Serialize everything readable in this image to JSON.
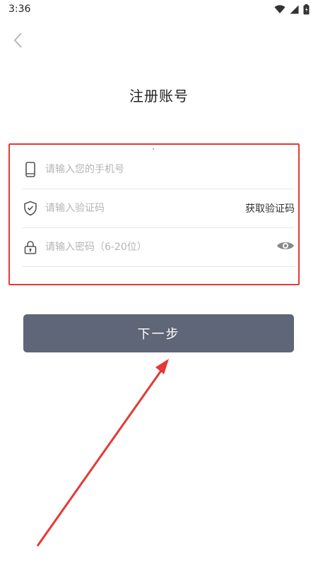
{
  "status_bar": {
    "time": "3:36",
    "icons": [
      "wifi-icon",
      "signal-icon",
      "battery-icon"
    ]
  },
  "header": {
    "back_icon": "chevron-left-icon",
    "title": "注册账号"
  },
  "form": {
    "phone": {
      "icon": "phone-icon",
      "placeholder": "请输入您的手机号",
      "value": ""
    },
    "code": {
      "icon": "shield-icon",
      "placeholder": "请输入验证码",
      "value": "",
      "action_label": "获取验证码"
    },
    "password": {
      "icon": "lock-icon",
      "placeholder": "请输入密码（6-20位）",
      "value": "",
      "toggle_icon": "eye-icon"
    }
  },
  "next_button": {
    "label": "下一步"
  },
  "colors": {
    "highlight_border": "#e53935",
    "button_bg": "#5f6677",
    "placeholder": "#b5b5b5",
    "divider": "#e6e6e6",
    "annotation_arrow": "#e53935"
  }
}
